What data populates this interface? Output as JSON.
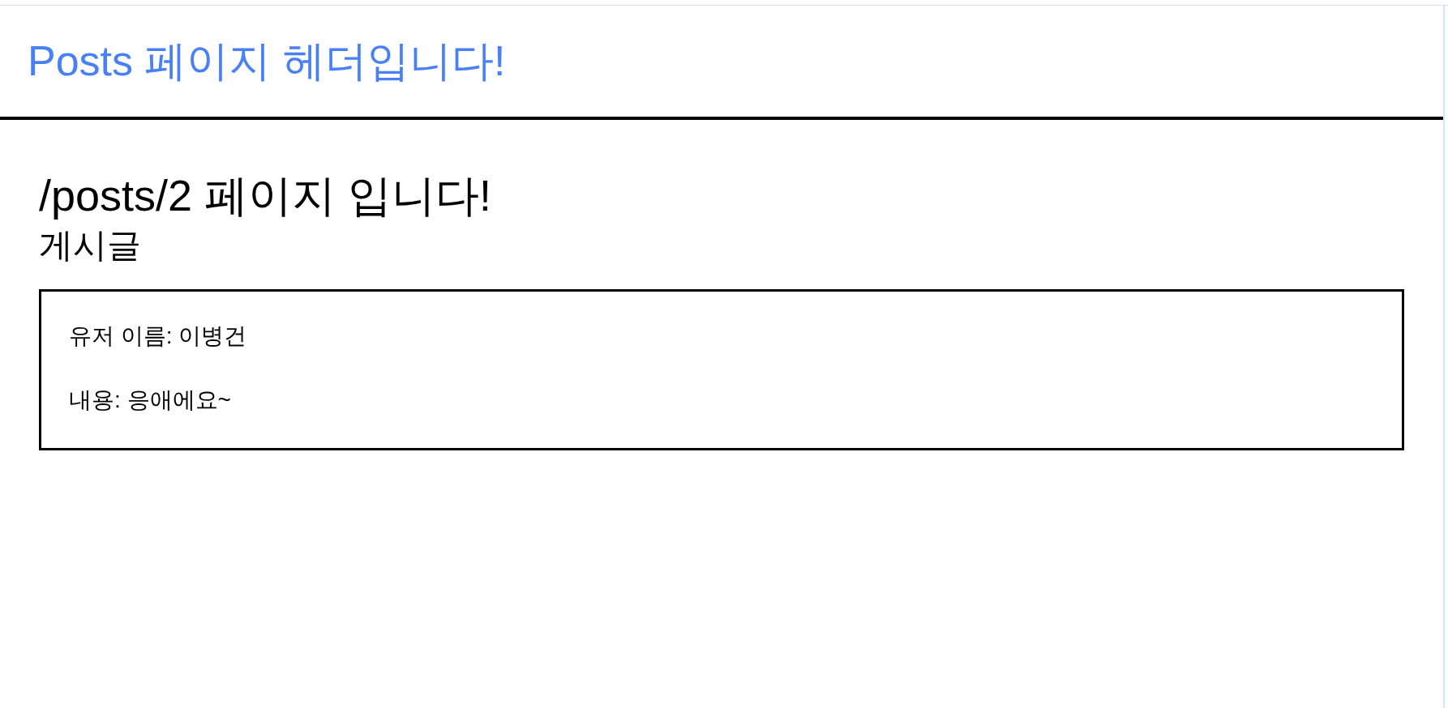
{
  "header": {
    "title": "Posts 페이지 헤더입니다!"
  },
  "page": {
    "heading": "/posts/2 페이지 입니다!",
    "subheading": "게시글"
  },
  "post": {
    "lines": [
      "유저 이름: 이병건",
      "내용: 응애에요~"
    ]
  }
}
